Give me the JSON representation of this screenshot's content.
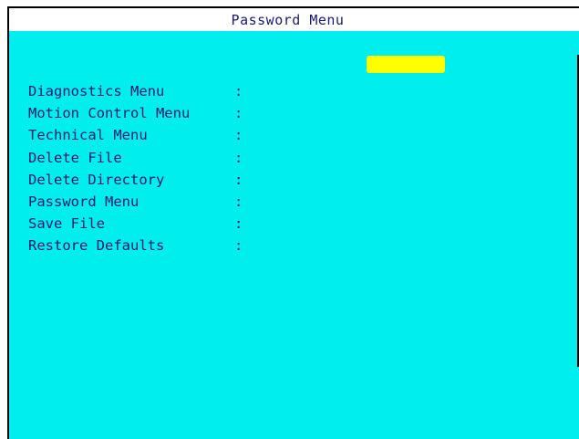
{
  "window": {
    "title": "Password Menu"
  },
  "password": {
    "value": ""
  },
  "menu": {
    "separator": ":",
    "items": [
      {
        "label": "Diagnostics Menu"
      },
      {
        "label": "Motion Control Menu"
      },
      {
        "label": "Technical Menu"
      },
      {
        "label": "Delete File"
      },
      {
        "label": "Delete Directory"
      },
      {
        "label": "Password Menu"
      },
      {
        "label": "Save File"
      },
      {
        "label": "Restore Defaults"
      }
    ]
  },
  "colors": {
    "panel_background": "#00eeee",
    "password_field": "#ffff00",
    "text": "#1a1a6e"
  }
}
